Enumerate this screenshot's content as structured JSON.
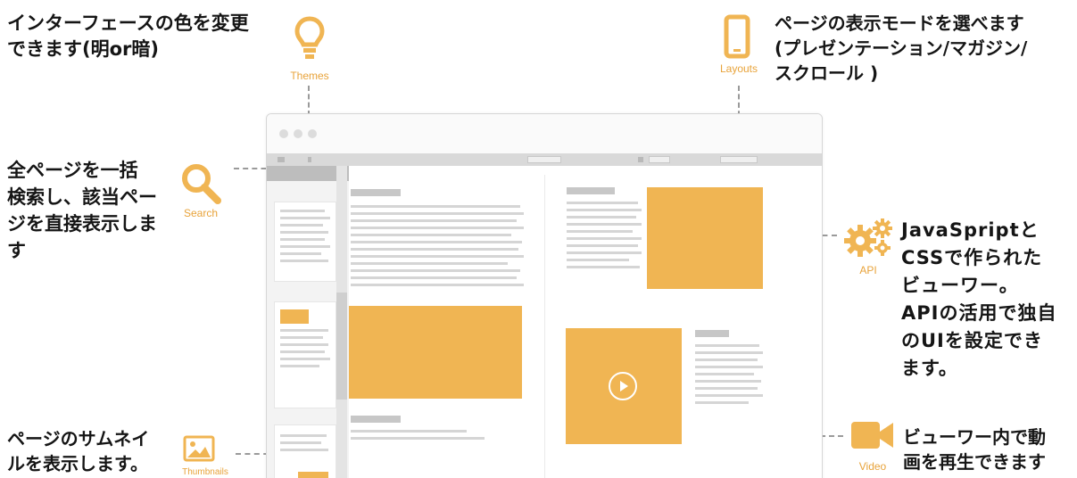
{
  "annotations": {
    "themes": "インターフェースの色を変更\nできます(明or暗)",
    "layouts": "ページの表示モードを選べます\n(プレゼンテーション/マガジン/\nスクロール )",
    "search": "全ページを一括\n検索し、該当ペー\nジを直接表示しま\nす",
    "api": "JavaSpriptと\nCSSで作られた\nビューワー。\nAPIの活用で独自\nのUIを設定でき\nます。",
    "thumbnails": "ページのサムネイ\nルを表示します。",
    "video": "ビューワー内で動\n画を再生できます"
  },
  "icon_labels": {
    "themes": "Themes",
    "layouts": "Layouts",
    "search": "Search",
    "api": "API",
    "thumbnails": "Thumbnails",
    "video": "Video"
  },
  "icons": [
    "lightbulb-icon",
    "smartphone-icon",
    "search-icon",
    "gears-icon",
    "image-icon",
    "video-camera-icon",
    "play-icon"
  ],
  "colors": {
    "accent": "#f0b553",
    "icon_orange": "#e8a33a",
    "text": "#151515",
    "dash": "#9a9a9a"
  }
}
